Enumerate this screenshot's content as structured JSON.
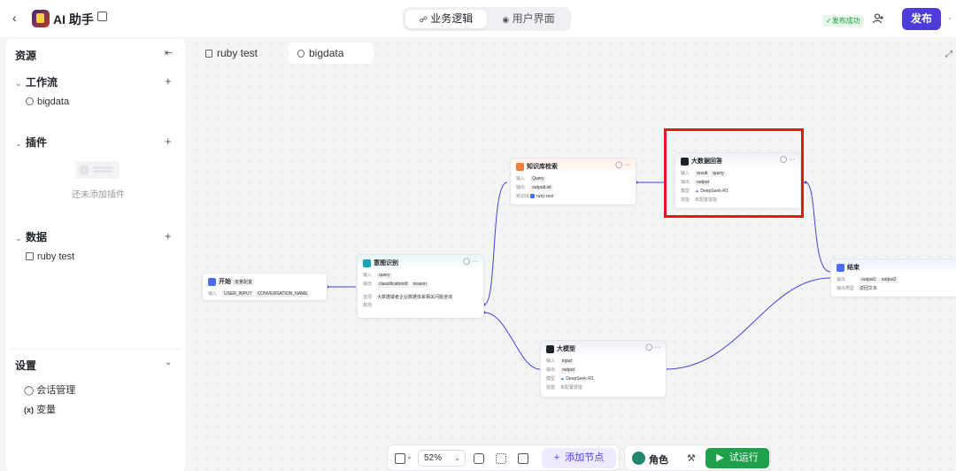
{
  "header": {
    "back_icon": "chevron-left-icon",
    "app_title": "AI 助手",
    "tabs": [
      {
        "label": "业务逻辑",
        "icon": "flow-icon",
        "active": true
      },
      {
        "label": "用户界面",
        "icon": "palette-icon",
        "active": false
      }
    ],
    "status_badge": "发布成功",
    "publish_label": "发布",
    "more_label": "·"
  },
  "sidebar": {
    "title": "资源",
    "sections": [
      {
        "label": "工作流",
        "items": [
          "bigdata"
        ]
      },
      {
        "label": "插件",
        "empty_text": "还未添加插件"
      },
      {
        "label": "数据",
        "items": [
          "ruby test"
        ]
      }
    ],
    "settings": {
      "title": "设置",
      "items": [
        {
          "label": "会话管理",
          "icon": "chat-manage-icon"
        },
        {
          "label": "变量",
          "icon_text": "(x)"
        }
      ]
    }
  },
  "canvas": {
    "tabs": [
      {
        "label": "ruby test",
        "icon": "doc-icon",
        "active": false
      },
      {
        "label": "bigdata",
        "icon": "flow-circle-icon",
        "active": true
      }
    ],
    "nodes": {
      "start": {
        "title": "开始",
        "tag": "变量配置",
        "input_label": "输入",
        "inputs": [
          "USER_INPUT",
          "CONVERSATION_NAME"
        ],
        "color": "#4d6bfe"
      },
      "intent": {
        "title": "意图识别",
        "input_label": "输入",
        "inputs": [
          "query"
        ],
        "output_label": "输出",
        "outputs": [
          "classificationId",
          "reason"
        ],
        "option_label": "选项",
        "option_value": "大数据或者企业数据体系相关问题咨询",
        "other_label": "其他",
        "color": "#17a2b8"
      },
      "knowledge": {
        "title": "知识库检索",
        "input_label": "输入",
        "inputs": [
          "Query"
        ],
        "output_label": "输出",
        "outputs": [
          "outputList"
        ],
        "kb_label": "知识库",
        "kb_value": "ruby test",
        "color": "#f07c3a"
      },
      "bigdata_reply": {
        "title": "大数据回答",
        "input_label": "输入",
        "inputs": [
          "result",
          "query"
        ],
        "output_label": "输出",
        "outputs": [
          "output"
        ],
        "model_label": "模型",
        "model_value": "DeepSeek-R1",
        "skill_label": "技能",
        "skill_value": "未配置技能",
        "color": "#1f2329"
      },
      "llm": {
        "title": "大模型",
        "input_label": "输入",
        "inputs": [
          "input"
        ],
        "output_label": "输出",
        "outputs": [
          "output"
        ],
        "model_label": "模型",
        "model_value": "DeepSeek-R1",
        "skill_label": "技能",
        "skill_value": "未配置技能",
        "color": "#1f2329"
      },
      "end": {
        "title": "结束",
        "output_label": "输出",
        "outputs": [
          "output1",
          "output2"
        ],
        "mode_label": "输出类型",
        "mode_value": "返回文本",
        "color": "#4d6bfe"
      }
    },
    "highlight_color": "#e5161d",
    "edge_color": "#4d3bdb"
  },
  "toolbar": {
    "zoom": "52%",
    "add_node_label": "添加节点",
    "role_label": "角色",
    "run_label": "试运行",
    "accent": "#4d3bdb",
    "run_color": "#1fa04a"
  }
}
